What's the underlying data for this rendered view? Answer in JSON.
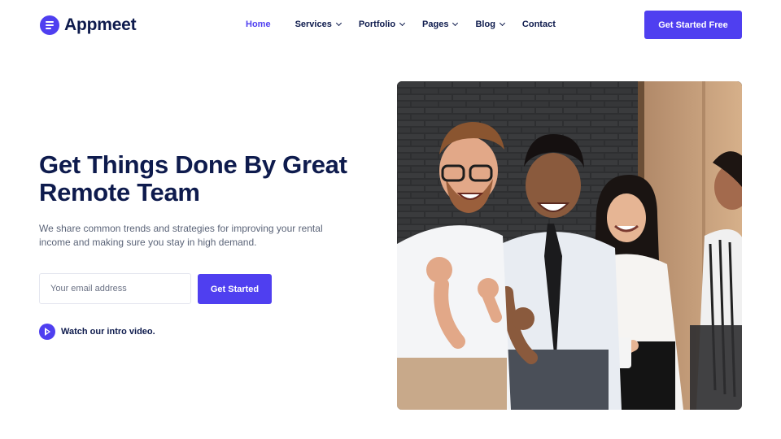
{
  "brand": {
    "name": "Appmeet",
    "logo_icon": "menu-lines-icon",
    "accent": "#4f3ff0",
    "text": "#0e1b4d"
  },
  "nav": {
    "items": [
      {
        "label": "Home",
        "active": true,
        "dropdown": false
      },
      {
        "label": "Services",
        "active": false,
        "dropdown": true
      },
      {
        "label": "Portfolio",
        "active": false,
        "dropdown": true
      },
      {
        "label": "Pages",
        "active": false,
        "dropdown": true
      },
      {
        "label": "Blog",
        "active": false,
        "dropdown": true
      },
      {
        "label": "Contact",
        "active": false,
        "dropdown": false
      }
    ],
    "cta_label": "Get Started Free"
  },
  "hero": {
    "title_line1": "Get Things Done By Great",
    "title_line2": "Remote Team",
    "subtitle": "We share common trends and strategies for improving your rental income and making sure you stay in high demand.",
    "email_placeholder": "Your email address",
    "email_value": "",
    "submit_label": "Get Started",
    "video_label": "Watch our intro video.",
    "video_icon": "play-icon"
  }
}
